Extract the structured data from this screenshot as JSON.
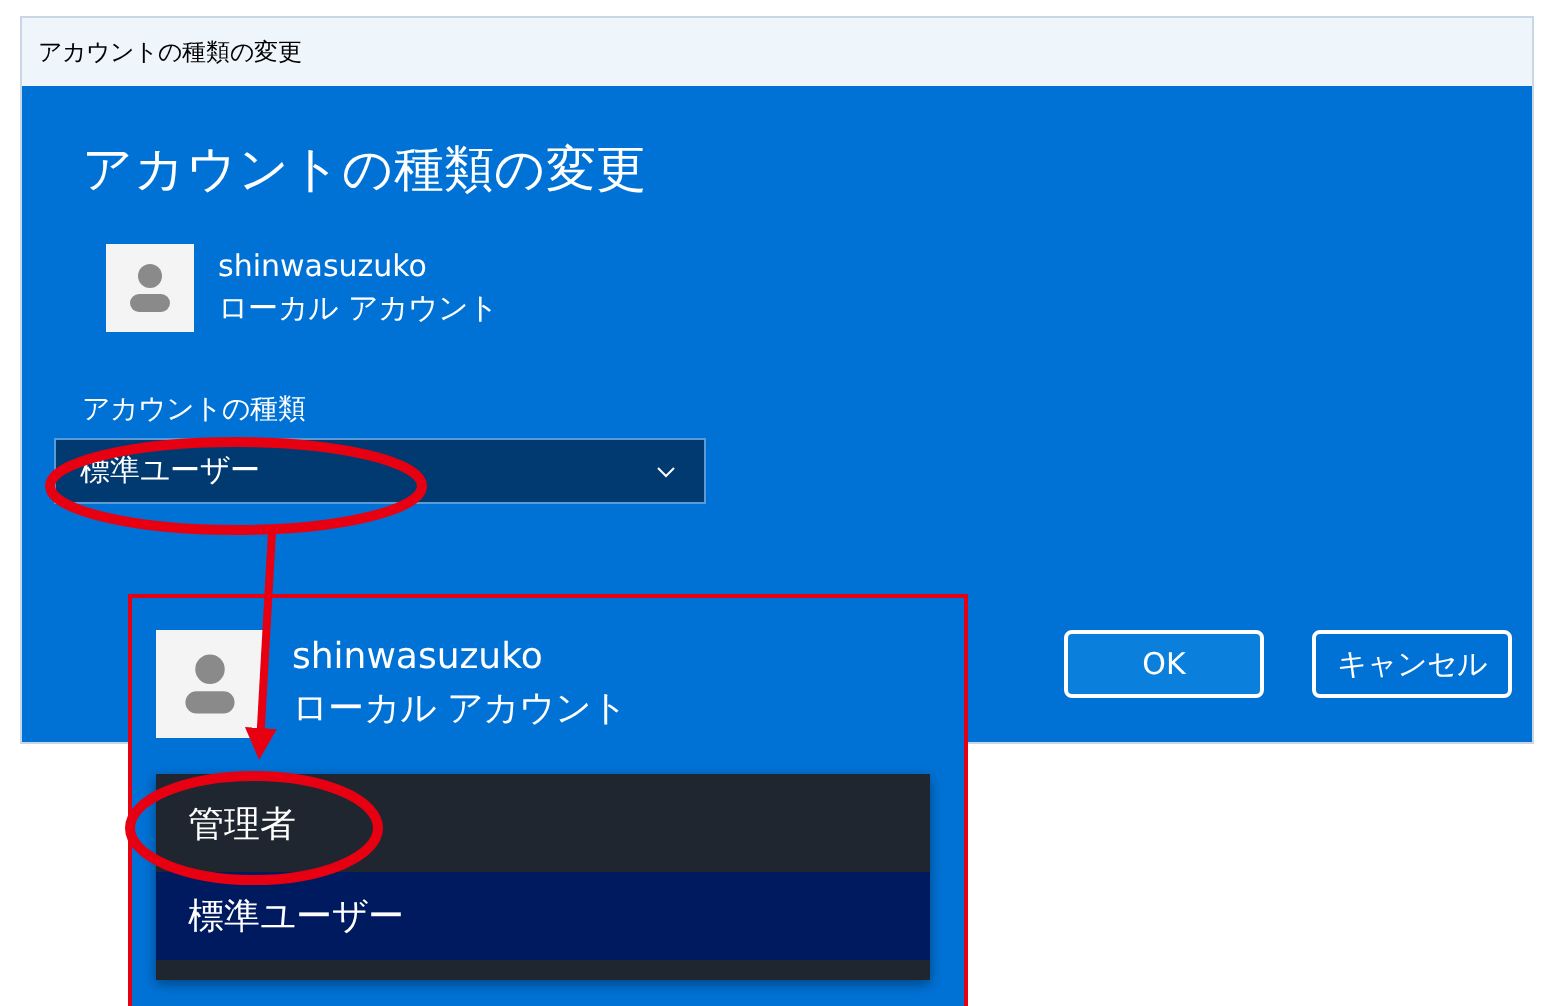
{
  "window": {
    "title": "アカウントの種類の変更"
  },
  "heading": "アカウントの種類の変更",
  "account": {
    "name": "shinwasuzuko",
    "type": "ローカル アカウント"
  },
  "account_type": {
    "label": "アカウントの種類",
    "value": "標準ユーザー"
  },
  "buttons": [
    {
      "label": "OK",
      "kind": "primary"
    },
    {
      "label": "キャンセル",
      "kind": "secondary"
    }
  ],
  "inset": {
    "account": {
      "name": "shinwasuzuko",
      "type": "ローカル アカウント"
    },
    "options": [
      {
        "label": "管理者",
        "selected": false
      },
      {
        "label": "標準ユーザー",
        "selected": true
      }
    ]
  },
  "annotations": [
    {
      "kind": "ellipse"
    },
    {
      "kind": "arrow"
    },
    {
      "kind": "ellipse"
    }
  ]
}
